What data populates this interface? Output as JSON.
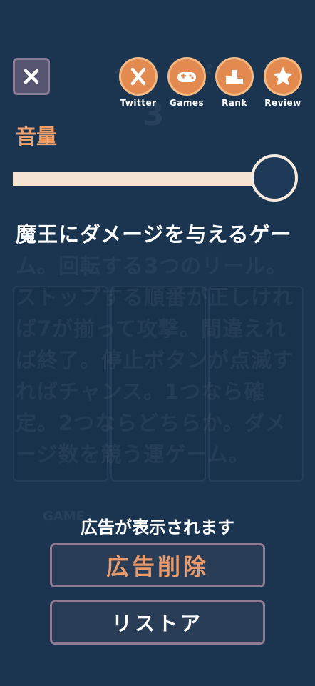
{
  "header": {
    "close_icon": "close-icon",
    "links": [
      {
        "label": "Twitter",
        "icon": "x-logo-icon"
      },
      {
        "label": "Games",
        "icon": "gamepad-icon"
      },
      {
        "label": "Rank",
        "icon": "podium-icon"
      },
      {
        "label": "Review",
        "icon": "star-icon"
      }
    ]
  },
  "volume": {
    "label": "音量",
    "level": 1.0
  },
  "description": {
    "first_line": "魔王にダメージを与えるゲー",
    "rest": "ム。回転する3つのリール。ストップする順番が正しければ7が揃って攻撃。間違えれば終了。停止ボタンが点滅すればチャンス。1つなら確定。2つならどちらか。ダメージ数を競う運ゲーム。"
  },
  "ad_notice": "広告が表示されます",
  "buttons": {
    "remove_ads": "広告削除",
    "restore": "リストア"
  },
  "colors": {
    "background": "#1b3550",
    "accent": "#e38a50",
    "accent_text": "#f0a06a",
    "button_border": "#8f7c93"
  }
}
